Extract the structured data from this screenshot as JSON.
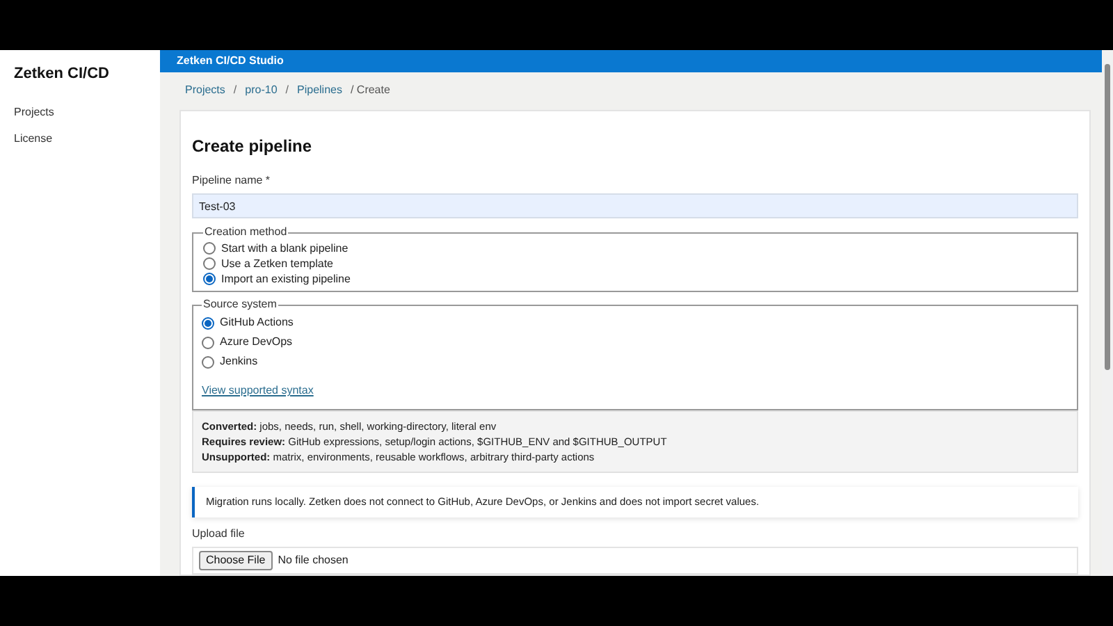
{
  "sidebar": {
    "title": "Zetken CI/CD",
    "items": [
      {
        "label": "Projects"
      },
      {
        "label": "License"
      }
    ]
  },
  "header": {
    "title": "Zetken CI/CD Studio"
  },
  "breadcrumb": {
    "links": [
      "Projects",
      "pro-10",
      "Pipelines"
    ],
    "separator": "/",
    "current": "/ Create"
  },
  "form": {
    "heading": "Create pipeline",
    "name_label": "Pipeline name *",
    "name_value": "Test-03",
    "creation_method": {
      "legend": "Creation method",
      "options": [
        {
          "label": "Start with a blank pipeline",
          "selected": false
        },
        {
          "label": "Use a Zetken template",
          "selected": false
        },
        {
          "label": "Import an existing pipeline",
          "selected": true
        }
      ]
    },
    "source_system": {
      "legend": "Source system",
      "options": [
        {
          "label": "GitHub Actions",
          "selected": true
        },
        {
          "label": "Azure DevOps",
          "selected": false
        },
        {
          "label": "Jenkins",
          "selected": false
        }
      ],
      "link": "View supported syntax"
    },
    "summary": [
      "**Converted:** jobs, needs, run, shell, working-directory, literal env",
      "**Requires review:** GitHub expressions, setup/login actions, $GITHUB_ENV and $GITHUB_OUTPUT",
      "**Unsupported:** matrix, environments, reusable workflows, arbitrary third-party actions"
    ],
    "notice": "Migration runs locally. Zetken does not connect to GitHub, Azure DevOps, or Jenkins and does not import secret values.",
    "upload_label": "Upload file",
    "choose_button": "Choose File",
    "file_status": "No file chosen"
  }
}
